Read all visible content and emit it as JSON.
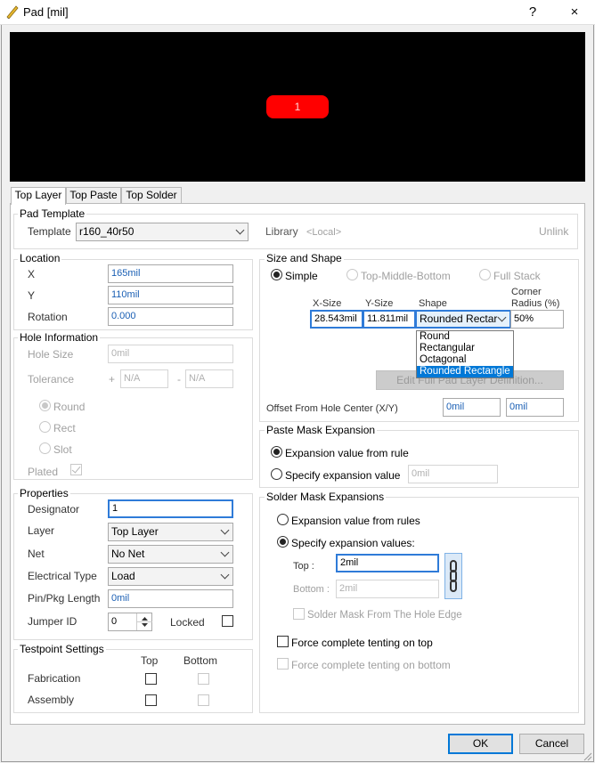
{
  "window": {
    "title": "Pad [mil]",
    "help": "?",
    "close": "×"
  },
  "preview": {
    "pad_label": "1",
    "pad_color": "#ff0000"
  },
  "tabs": [
    {
      "label": "Top Layer"
    },
    {
      "label": "Top Paste"
    },
    {
      "label": "Top Solder"
    }
  ],
  "pad_template": {
    "legend": "Pad Template",
    "template_label": "Template",
    "template_value": "r160_40r50",
    "library_label": "Library",
    "library_value": "<Local>",
    "unlink": "Unlink"
  },
  "location": {
    "legend": "Location",
    "x_label": "X",
    "x_value": "165mil",
    "y_label": "Y",
    "y_value": "110mil",
    "rotation_label": "Rotation",
    "rotation_value": "0.000"
  },
  "hole": {
    "legend": "Hole Information",
    "size_label": "Hole Size",
    "size_value": "0mil",
    "tolerance_label": "Tolerance",
    "plus": "+",
    "minus": "-",
    "tol_plus": "N/A",
    "tol_minus": "N/A",
    "round": "Round",
    "rect": "Rect",
    "slot": "Slot",
    "plated": "Plated"
  },
  "properties": {
    "legend": "Properties",
    "designator_label": "Designator",
    "designator_value": "1",
    "layer_label": "Layer",
    "layer_value": "Top Layer",
    "net_label": "Net",
    "net_value": "No Net",
    "etype_label": "Electrical Type",
    "etype_value": "Load",
    "pinpkg_label": "Pin/Pkg Length",
    "pinpkg_value": "0mil",
    "jumper_label": "Jumper ID",
    "jumper_value": "0",
    "locked_label": "Locked"
  },
  "testpoint": {
    "legend": "Testpoint Settings",
    "top": "Top",
    "bottom": "Bottom",
    "fabrication": "Fabrication",
    "assembly": "Assembly"
  },
  "size_shape": {
    "legend": "Size and Shape",
    "simple": "Simple",
    "tmb": "Top-Middle-Bottom",
    "full_stack": "Full Stack",
    "xsize_label": "X-Size",
    "ysize_label": "Y-Size",
    "shape_label": "Shape",
    "corner_label1": "Corner",
    "corner_label2": "Radius (%)",
    "xsize_value": "28.543mil",
    "ysize_value": "11.811mil",
    "shape_value": "Rounded Rectar",
    "corner_value": "50%",
    "shape_options": [
      "Round",
      "Rectangular",
      "Octagonal",
      "Rounded Rectangle"
    ],
    "edit_button": "Edit Full Pad Layer Definition...",
    "offset_label": "Offset From Hole Center (X/Y)",
    "offset_x": "0mil",
    "offset_y": "0mil"
  },
  "paste_mask": {
    "legend": "Paste Mask Expansion",
    "from_rule": "Expansion value from rule",
    "specify": "Specify expansion value",
    "value": "0mil"
  },
  "solder_mask": {
    "legend": "Solder Mask Expansions",
    "from_rules": "Expansion value from rules",
    "specify": "Specify expansion values:",
    "top_label": "Top :",
    "top_value": "2mil",
    "bottom_label": "Bottom :",
    "bottom_value": "2mil",
    "from_hole": "Solder Mask From The Hole Edge",
    "tent_top": "Force complete tenting on top",
    "tent_bottom": "Force complete tenting on bottom"
  },
  "buttons": {
    "ok": "OK",
    "cancel": "Cancel"
  }
}
